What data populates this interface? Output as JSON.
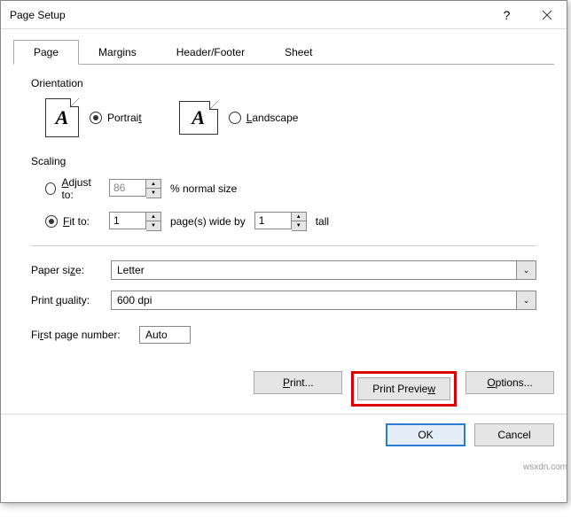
{
  "title": "Page Setup",
  "tabs": [
    "Page",
    "Margins",
    "Header/Footer",
    "Sheet"
  ],
  "orientation": {
    "label": "Orientation",
    "portrait": "Portrait",
    "landscape": "Landscape"
  },
  "scaling": {
    "label": "Scaling",
    "adjust_to": "Adjust to:",
    "adjust_value": "86",
    "adjust_suffix": "% normal size",
    "fit_to": "Fit to:",
    "fit_wide": "1",
    "fit_mid": "page(s) wide by",
    "fit_tall": "1",
    "fit_suffix": "tall"
  },
  "paper_size": {
    "label": "Paper size:",
    "value": "Letter"
  },
  "print_quality": {
    "label": "Print quality:",
    "value": "600 dpi"
  },
  "first_page": {
    "label": "First page number:",
    "value": "Auto"
  },
  "buttons": {
    "print": "Print...",
    "preview": "Print Preview",
    "options": "Options...",
    "ok": "OK",
    "cancel": "Cancel"
  },
  "watermark": "wsxdn.com"
}
